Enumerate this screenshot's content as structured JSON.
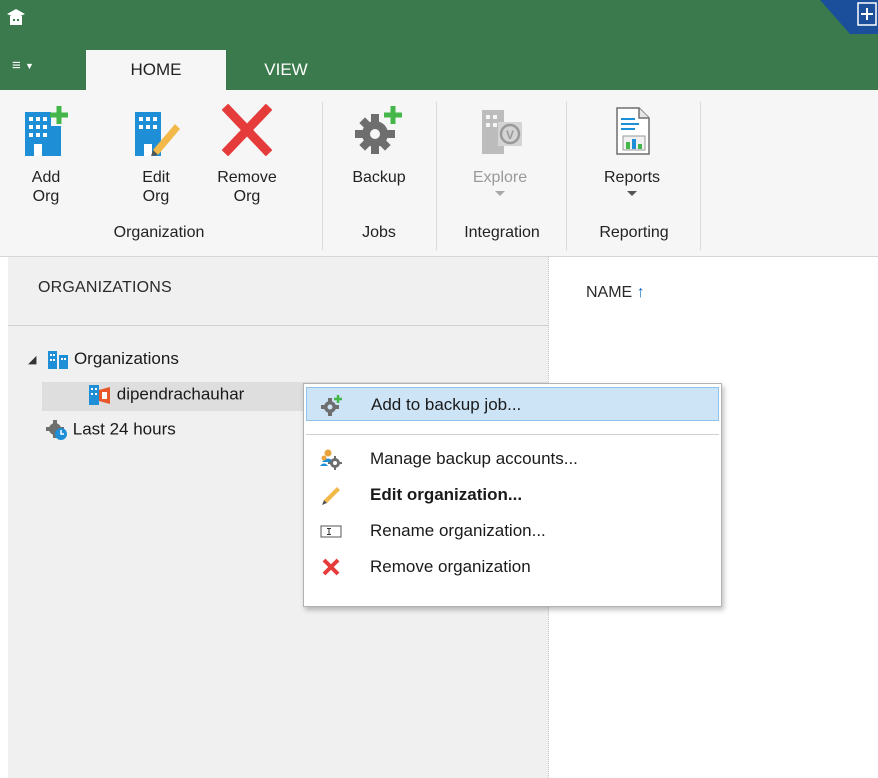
{
  "ribbon": {
    "tabs": [
      {
        "label": "HOME",
        "active": true
      },
      {
        "label": "VIEW",
        "active": false
      }
    ],
    "buttons": {
      "add_org": {
        "line1": "Add",
        "line2": "Org",
        "icon": "add-org-icon"
      },
      "edit_org": {
        "line1": "Edit",
        "line2": "Org",
        "icon": "edit-org-icon"
      },
      "remove_org": {
        "line1": "Remove",
        "line2": "Org",
        "icon": "remove-icon"
      },
      "backup": {
        "label": "Backup",
        "icon": "backup-job-icon"
      },
      "explore": {
        "label": "Explore",
        "icon": "explorer-icon",
        "disabled": true
      },
      "reports": {
        "label": "Reports",
        "icon": "report-icon"
      }
    },
    "groups": {
      "organization": "Organization",
      "jobs": "Jobs",
      "integration": "Integration",
      "reporting": "Reporting"
    }
  },
  "left_pane": {
    "header": "ORGANIZATIONS",
    "tree": {
      "root": "Organizations",
      "org": "dipendrachauhar",
      "last24": "Last 24 hours"
    }
  },
  "right_pane": {
    "column_name": "NAME",
    "sort_arrow": "↑"
  },
  "context_menu": {
    "items": [
      {
        "label": "Add to backup job...",
        "icon": "backup-job-icon",
        "highlighted": true,
        "bold": false
      },
      {
        "label": "Manage backup accounts...",
        "icon": "accounts-gear-icon",
        "highlighted": false,
        "bold": false
      },
      {
        "label": "Edit organization...",
        "icon": "pencil-icon",
        "highlighted": false,
        "bold": true
      },
      {
        "label": "Rename organization...",
        "icon": "rename-icon",
        "highlighted": false,
        "bold": false
      },
      {
        "label": "Remove organization",
        "icon": "remove-icon",
        "highlighted": false,
        "bold": false
      }
    ]
  },
  "colors": {
    "titlebar": "#3a7a4c",
    "ribbon_bg": "#f6f6f6",
    "menu_highlight": "#cde4f7",
    "remove_red": "#e63b3b",
    "add_green": "#45b649"
  }
}
